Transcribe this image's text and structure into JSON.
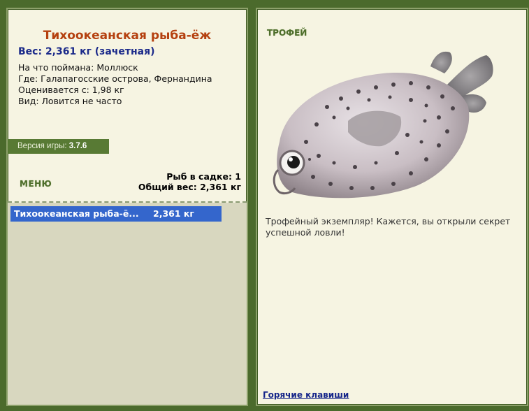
{
  "fish": {
    "name": "Тихоокеанская рыба-ёж",
    "weight_line": "Вес: 2,361 кг (зачетная)",
    "bait_line": "На что поймана: Моллюск",
    "location_line": "Где: Галапагосские острова, Фернандина",
    "min_weight_line": "Оценивается с: 1,98 кг",
    "rarity_line": "Вид: Ловится не часто"
  },
  "version": {
    "label": "Версия игры:",
    "value": "3.7.6"
  },
  "menu_label": "МЕНЮ",
  "stats": {
    "fish_count_line": "Рыб в садке: 1",
    "total_weight_line": "Общий вес: 2,361 кг"
  },
  "catch_list": [
    {
      "name": "Тихоокеанская рыба-ё...",
      "weight": "2,361 кг"
    }
  ],
  "trophy": {
    "label": "ТРОФЕЙ",
    "message": "Трофейный экземпляр! Кажется, вы открыли секрет успешной ловли!"
  },
  "hotkeys_link": "Горячие клавиши",
  "colors": {
    "background": "#4b6a2c",
    "panel": "#f6f4e2",
    "title": "#b5400f",
    "weight": "#1b2a8a",
    "selection": "#3466cc",
    "accent_green": "#587a34"
  }
}
